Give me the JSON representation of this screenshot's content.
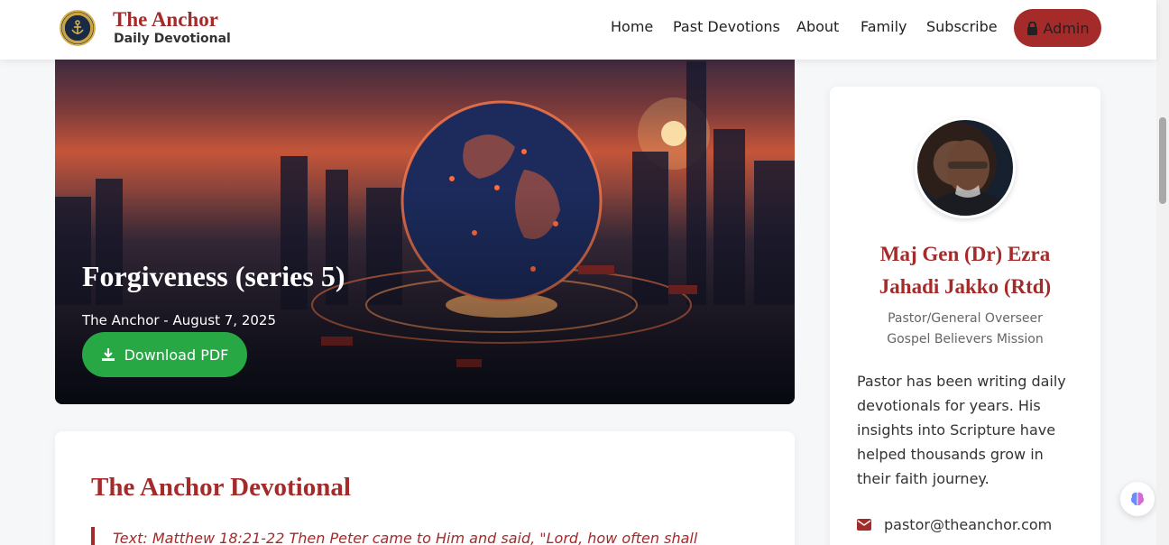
{
  "header": {
    "brand_title": "The Anchor",
    "brand_subtitle": "Daily Devotional",
    "nav": [
      "Home",
      "Past Devotions",
      "About",
      "Family",
      "Subscribe"
    ],
    "admin_label": "Admin"
  },
  "hero": {
    "title": "Forgiveness (series 5)",
    "meta": "The Anchor - August 7, 2025",
    "download_label": "Download PDF"
  },
  "devotional": {
    "heading": "The Anchor Devotional",
    "text": "Text: Matthew 18:21-22 Then Peter came to Him and said, \"Lord, how often shall"
  },
  "sidebar": {
    "name": "Maj Gen (Dr) Ezra Jahadi Jakko (Rtd)",
    "role": "Pastor/General Overseer",
    "org": "Gospel Believers Mission",
    "bio": "Pastor has been writing daily devotionals for years. His insights into Scripture have helped thousands grow in their faith journey.",
    "email": "pastor@theanchor.com"
  },
  "colors": {
    "brand": "#a52a2a",
    "download": "#28a745"
  },
  "icons": [
    "anchor-logo-icon",
    "lock-icon",
    "download-icon",
    "envelope-icon",
    "brain-icon"
  ]
}
